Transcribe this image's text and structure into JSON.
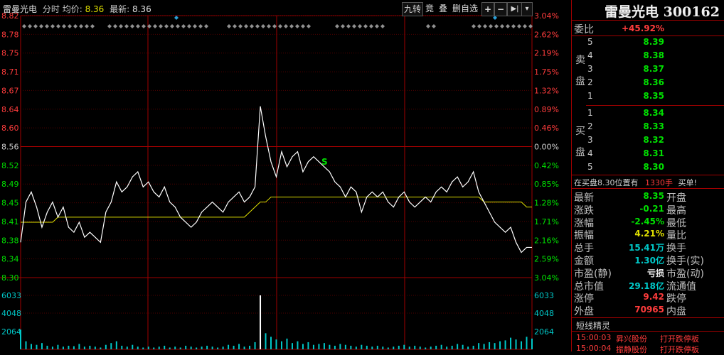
{
  "header": {
    "stock_name": "雷曼光电",
    "view": "分时",
    "avg_label": "均价:",
    "avg_value": "8.36",
    "last_label": "最新:",
    "last_value": "8.36"
  },
  "toolbar": {
    "jiuzhuan": "九转",
    "jing": "竟",
    "die": "叠",
    "delete_custom": "删自选",
    "plus": "+",
    "minus": "−",
    "skip": "▶|",
    "menu": "▾"
  },
  "price_axis": [
    "8.82",
    "8.78",
    "8.75",
    "8.71",
    "8.67",
    "8.64",
    "8.60",
    "8.56",
    "8.52",
    "8.49",
    "8.45",
    "8.41",
    "8.38",
    "8.34",
    "8.30"
  ],
  "pct_axis": [
    "3.04%",
    "2.62%",
    "2.19%",
    "1.75%",
    "1.32%",
    "0.89%",
    "0.46%",
    "0.00%",
    "0.42%",
    "0.85%",
    "1.28%",
    "1.71%",
    "2.16%",
    "2.59%",
    "3.04%"
  ],
  "volume_axis": [
    "6033",
    "4048",
    "2064"
  ],
  "signal_label": "S",
  "chart_data": {
    "type": "line",
    "title": "",
    "prev_close": 8.56,
    "ylim": [
      8.3,
      8.82
    ],
    "series": [
      {
        "name": "price",
        "values": [
          8.37,
          8.45,
          8.47,
          8.44,
          8.4,
          8.43,
          8.45,
          8.42,
          8.44,
          8.4,
          8.39,
          8.41,
          8.38,
          8.39,
          8.38,
          8.37,
          8.43,
          8.45,
          8.49,
          8.47,
          8.48,
          8.5,
          8.51,
          8.48,
          8.49,
          8.47,
          8.46,
          8.48,
          8.45,
          8.44,
          8.42,
          8.41,
          8.4,
          8.41,
          8.43,
          8.44,
          8.45,
          8.44,
          8.43,
          8.45,
          8.46,
          8.47,
          8.45,
          8.46,
          8.48,
          8.64,
          8.58,
          8.53,
          8.5,
          8.55,
          8.52,
          8.54,
          8.55,
          8.51,
          8.53,
          8.54,
          8.53,
          8.52,
          8.51,
          8.49,
          8.48,
          8.46,
          8.48,
          8.47,
          8.43,
          8.46,
          8.47,
          8.46,
          8.47,
          8.45,
          8.44,
          8.46,
          8.47,
          8.45,
          8.44,
          8.45,
          8.46,
          8.45,
          8.47,
          8.48,
          8.47,
          8.49,
          8.5,
          8.48,
          8.49,
          8.51,
          8.47,
          8.45,
          8.43,
          8.41,
          8.4,
          8.39,
          8.4,
          8.37,
          8.35,
          8.36,
          8.36
        ]
      },
      {
        "name": "average",
        "values": [
          8.41,
          8.41,
          8.41,
          8.41,
          8.41,
          8.41,
          8.41,
          8.42,
          8.42,
          8.42,
          8.42,
          8.42,
          8.42,
          8.42,
          8.42,
          8.42,
          8.42,
          8.42,
          8.42,
          8.42,
          8.42,
          8.42,
          8.42,
          8.42,
          8.42,
          8.42,
          8.42,
          8.42,
          8.42,
          8.42,
          8.42,
          8.42,
          8.42,
          8.42,
          8.42,
          8.42,
          8.42,
          8.42,
          8.42,
          8.42,
          8.42,
          8.42,
          8.42,
          8.43,
          8.44,
          8.45,
          8.45,
          8.46,
          8.46,
          8.46,
          8.46,
          8.46,
          8.46,
          8.46,
          8.46,
          8.46,
          8.46,
          8.46,
          8.46,
          8.46,
          8.46,
          8.46,
          8.46,
          8.46,
          8.46,
          8.46,
          8.46,
          8.46,
          8.46,
          8.46,
          8.46,
          8.46,
          8.46,
          8.46,
          8.46,
          8.46,
          8.46,
          8.46,
          8.46,
          8.46,
          8.46,
          8.46,
          8.46,
          8.46,
          8.46,
          8.46,
          8.46,
          8.45,
          8.45,
          8.45,
          8.45,
          8.45,
          8.45,
          8.45,
          8.45,
          8.44,
          8.44
        ]
      },
      {
        "name": "volume",
        "values": [
          2200,
          900,
          600,
          500,
          700,
          400,
          300,
          500,
          300,
          400,
          350,
          600,
          300,
          400,
          300,
          200,
          500,
          700,
          900,
          400,
          300,
          500,
          300,
          200,
          300,
          200,
          300,
          400,
          200,
          300,
          200,
          400,
          300,
          200,
          300,
          400,
          300,
          200,
          300,
          500,
          400,
          600,
          300,
          400,
          800,
          6033,
          1800,
          1400,
          1100,
          900,
          1200,
          700,
          900,
          600,
          800,
          500,
          600,
          700,
          500,
          400,
          600,
          500,
          400,
          300,
          500,
          400,
          300,
          400,
          300,
          200,
          300,
          400,
          500,
          300,
          400,
          300,
          200,
          300,
          400,
          500,
          300,
          400,
          600,
          500,
          300,
          400,
          700,
          600,
          800,
          700,
          900,
          1000,
          1300,
          1100,
          900,
          1400,
          1200
        ]
      }
    ]
  },
  "side": {
    "title": "雷曼光电 300162",
    "weibi_label": "委比",
    "weibi_value": "+45.92%",
    "sell_label": [
      "卖",
      "盘"
    ],
    "buy_label": [
      "买",
      "盘"
    ],
    "sells": [
      {
        "n": "5",
        "p": "8.39"
      },
      {
        "n": "4",
        "p": "8.38"
      },
      {
        "n": "3",
        "p": "8.37"
      },
      {
        "n": "2",
        "p": "8.36"
      },
      {
        "n": "1",
        "p": "8.35"
      }
    ],
    "buys": [
      {
        "n": "1",
        "p": "8.34"
      },
      {
        "n": "2",
        "p": "8.33"
      },
      {
        "n": "3",
        "p": "8.32"
      },
      {
        "n": "4",
        "p": "8.31"
      },
      {
        "n": "5",
        "p": "8.30"
      }
    ],
    "notice_a": "在买盘8.30位置有",
    "notice_b": "1330手",
    "notice_c": "买单!",
    "stats": [
      {
        "l": "最新",
        "v": "8.35",
        "vc": "green",
        "r": "开盘"
      },
      {
        "l": "涨跌",
        "v": "-0.21",
        "vc": "green",
        "r": "最高"
      },
      {
        "l": "涨幅",
        "v": "-2.45%",
        "vc": "green",
        "r": "最低"
      },
      {
        "l": "振幅",
        "v": "4.21%",
        "vc": "yellow",
        "r": "量比"
      },
      {
        "l": "总手",
        "v": "15.41万",
        "vc": "cyan",
        "r": "换手"
      },
      {
        "l": "金额",
        "v": "1.30亿",
        "vc": "cyan",
        "r": "换手(实)"
      },
      {
        "l": "市盈(静)",
        "v": "亏损",
        "vc": "white",
        "r": "市盈(动)"
      },
      {
        "l": "总市值",
        "v": "29.18亿",
        "vc": "cyan",
        "r": "流通值"
      },
      {
        "l": "涨停",
        "v": "9.42",
        "vc": "red",
        "r": "跌停"
      },
      {
        "l": "外盘",
        "v": "70965",
        "vc": "red",
        "r": "内盘"
      }
    ],
    "short_title": "短线精灵",
    "short_rows": [
      {
        "t": "15:00:03",
        "n": "昇兴股份",
        "e": "打开跌停板"
      },
      {
        "t": "15:00:04",
        "n": "振静股份",
        "e": "打开跌停板"
      }
    ]
  }
}
